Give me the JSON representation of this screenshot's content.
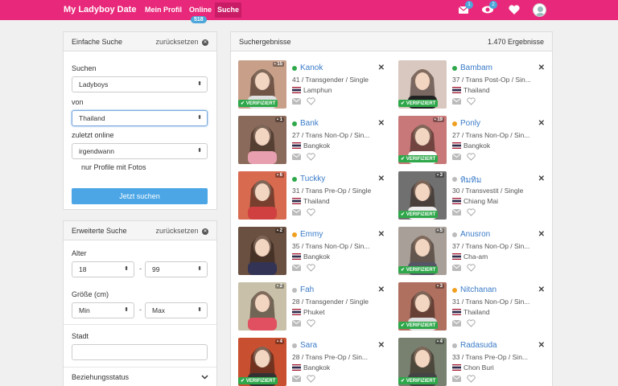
{
  "brand": "My Ladyboy Date",
  "nav": {
    "profile": "Mein Profil",
    "online": "Online",
    "online_count": "518",
    "search": "Suche"
  },
  "icons": {
    "mail_badge": "1",
    "eye_badge": "2"
  },
  "simple": {
    "title": "Einfache Suche",
    "reset": "zurücksetzen",
    "search_label": "Suchen",
    "search_value": "Ladyboys",
    "from_label": "von",
    "from_value": "Thailand",
    "online_label": "zuletzt online",
    "online_value": "irgendwann",
    "photos_label": "nur Profile mit Fotos",
    "submit": "Jetzt suchen"
  },
  "advanced": {
    "title": "Erweiterte Suche",
    "reset": "zurücksetzen",
    "age_label": "Alter",
    "age_min": "18",
    "age_max": "99",
    "height_label": "Größe (cm)",
    "height_min": "Min",
    "height_max": "Max",
    "city_label": "Stadt",
    "relationship_label": "Beziehungsstatus"
  },
  "results": {
    "title": "Suchergebnisse",
    "count": "1.470 Ergebnisse",
    "verified_label": "VERIFIZIERT",
    "cards": [
      {
        "name": "Kanok",
        "detail": "41 / Transgender / Single",
        "location": "Lamphun",
        "photos": "15",
        "status": "#2ea84a",
        "photo_color": "#c8a08a"
      },
      {
        "name": "Bambam",
        "detail": "37 / Trans Post-Op / Sin...",
        "location": "Thailand",
        "photos": "",
        "status": "#2ea84a",
        "photo_color": "#d8c8c0"
      },
      {
        "name": "Bank",
        "detail": "27 / Trans Non-Op / Sin...",
        "location": "Bangkok",
        "photos": "1",
        "status": "#2ea84a",
        "photo_color": "#8a6a5a"
      },
      {
        "name": "Ponly",
        "detail": "27 / Trans Non-Op / Sin...",
        "location": "Bangkok",
        "photos": "19",
        "status": "#f0a020",
        "photo_color": "#c87878"
      },
      {
        "name": "Tuckky",
        "detail": "31 / Trans Pre-Op / Single",
        "location": "Thailand",
        "photos": "6",
        "status": "#2ea84a",
        "photo_color": "#d86a50"
      },
      {
        "name": "ทิมทิม",
        "detail": "30 / Transvestit / Single",
        "location": "Chiang Mai",
        "photos": "3",
        "status": "#bbbbbb",
        "photo_color": "#707070"
      },
      {
        "name": "Emmy",
        "detail": "35 / Trans Non-Op / Sin...",
        "location": "Bangkok",
        "photos": "2",
        "status": "#f0a020",
        "photo_color": "#6a5040"
      },
      {
        "name": "Anusron",
        "detail": "37 / Trans Non-Op / Sin...",
        "location": "Cha-am",
        "photos": "5",
        "status": "#bbbbbb",
        "photo_color": "#a8a098"
      },
      {
        "name": "Fah",
        "detail": "28 / Transgender / Single",
        "location": "Phuket",
        "photos": "2",
        "status": "#bbbbbb",
        "photo_color": "#c8c0a8"
      },
      {
        "name": "Nitchanan",
        "detail": "31 / Trans Non-Op / Sin...",
        "location": "Thailand",
        "photos": "3",
        "status": "#f0a020",
        "photo_color": "#b07060"
      },
      {
        "name": "Sara",
        "detail": "28 / Trans Pre-Op / Sin...",
        "location": "Bangkok",
        "photos": "4",
        "status": "#bbbbbb",
        "photo_color": "#c85030"
      },
      {
        "name": "Radasuda",
        "detail": "33 / Trans Pre-Op / Sin...",
        "location": "Chon Buri",
        "photos": "4",
        "status": "#bbbbbb",
        "photo_color": "#788070"
      }
    ]
  }
}
